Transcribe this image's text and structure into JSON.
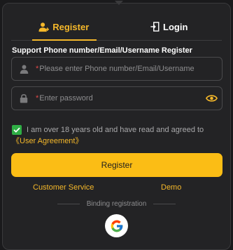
{
  "tabs": {
    "register_label": "Register",
    "login_label": "Login",
    "active": "register"
  },
  "form": {
    "subtitle": "Support Phone number/Email/Username Register",
    "account_placeholder": "Please enter Phone number/Email/Username",
    "password_placeholder": "Enter password",
    "required_mark": "*"
  },
  "agreement": {
    "checked": true,
    "text": "I am over 18 years old and have read and agreed to ",
    "link_label": "《User Agreement》"
  },
  "register_button_label": "Register",
  "footer": {
    "customer_service_label": "Customer Service",
    "demo_label": "Demo",
    "binding_label": "Binding registration"
  },
  "icons": {
    "register_tab": "user-plus-icon",
    "login_tab": "login-door-icon",
    "account_field": "user-icon",
    "password_field": "lock-icon",
    "password_toggle": "eye-icon",
    "agree_checkbox": "checkmark-icon",
    "social_login": "google-icon"
  },
  "colors": {
    "accent": "#f5b82a",
    "button": "#fbbd15",
    "checkbox": "#2fae45",
    "required": "#e04848",
    "panel_background": "#232325"
  }
}
